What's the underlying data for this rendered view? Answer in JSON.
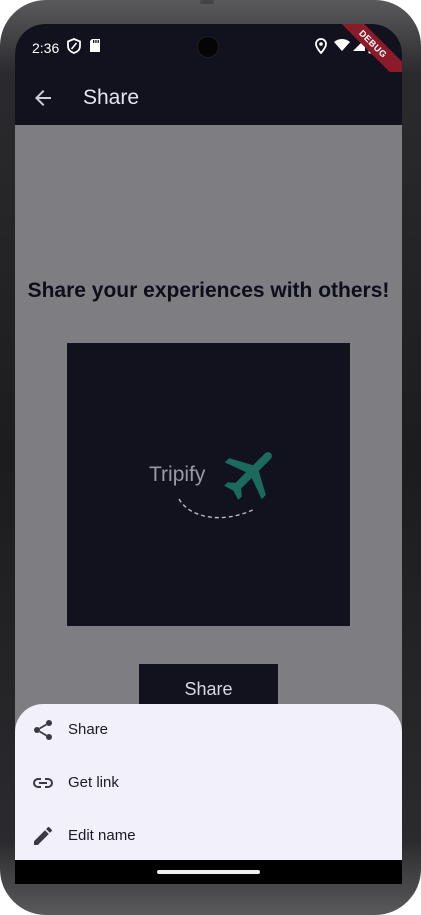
{
  "status": {
    "time": "2:36",
    "debug_label": "DEBUG"
  },
  "appbar": {
    "title": "Share"
  },
  "content": {
    "headline": "Share your experiences with others!",
    "logo_text": "Tripify",
    "share_button": "Share"
  },
  "sheet": {
    "items": [
      {
        "label": "Share",
        "icon": "share-icon"
      },
      {
        "label": "Get link",
        "icon": "link-icon"
      },
      {
        "label": "Edit name",
        "icon": "pencil-icon"
      }
    ]
  },
  "colors": {
    "appbar": "#12121f",
    "scrim": "#7e7d81",
    "sheet": "#f1f0fb",
    "plane": "#1b6a5e",
    "debug_ribbon": "#8b1a2a"
  }
}
